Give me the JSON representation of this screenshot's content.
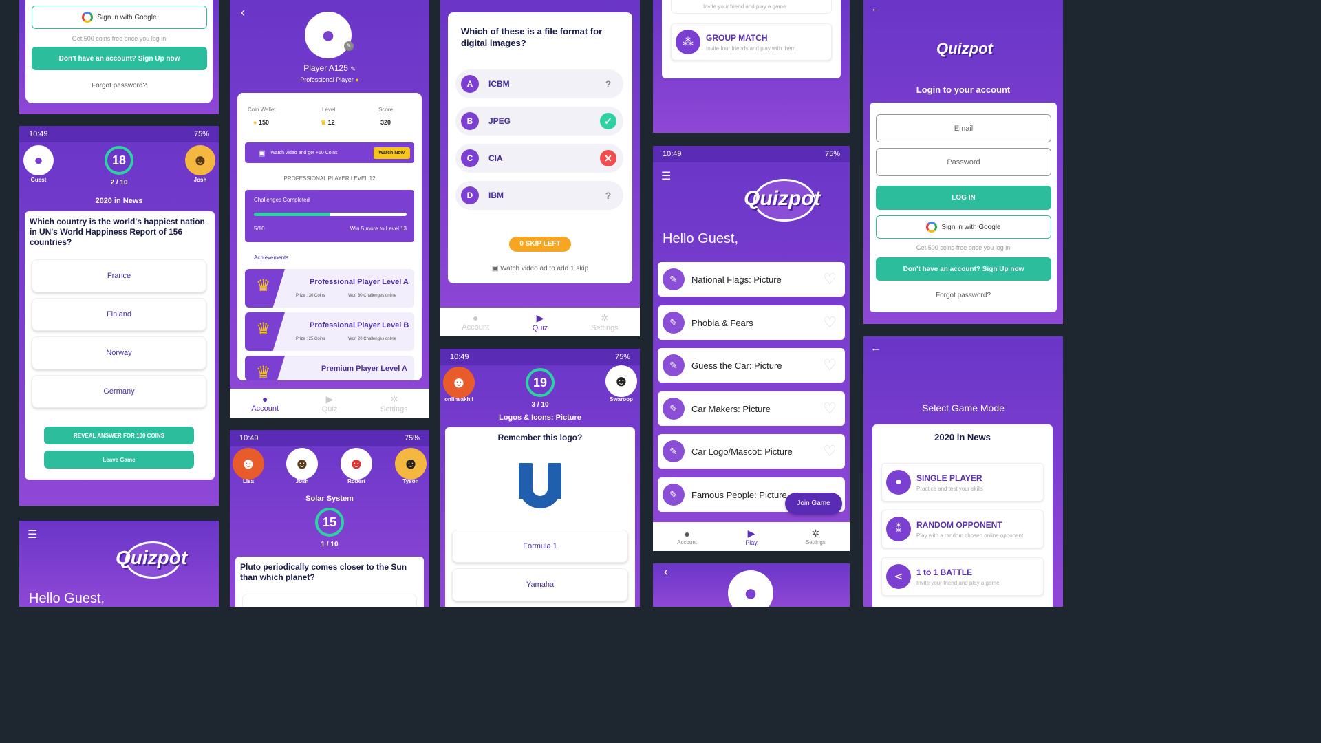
{
  "colors": {
    "purple": "#6a36c8",
    "teal": "#2bbd9c",
    "accent": "#2ed1a2",
    "orange": "#f6a623",
    "red": "#f04e4e",
    "yellow": "#f5c518"
  },
  "s1": {
    "google": "Sign in with Google",
    "coins_note": "Get 500 coins free once you log in",
    "signup": "Don't have an account? Sign Up now",
    "forgot": "Forgot password?"
  },
  "s2": {
    "time": "10:49",
    "battery": "75%",
    "p1": "Guest",
    "p2": "Josh",
    "timer": "18",
    "progress": "2 / 10",
    "topic": "2020 in News",
    "question": "Which country is the world's happiest nation in UN's World Happiness Report of 156 countries?",
    "answers": [
      "France",
      "Finland",
      "Norway",
      "Germany"
    ],
    "reveal": "REVEAL ANSWER FOR 100 COINS",
    "leave": "Leave Game"
  },
  "s3": {
    "greeting": "Hello Guest,",
    "logo": "Quizpot"
  },
  "s4": {
    "name": "Player A125",
    "subtitle": "Professional Player",
    "wallet_label": "Coin Wallet",
    "wallet": "150",
    "level_label": "Level",
    "level": "12",
    "score_label": "Score",
    "score": "320",
    "watch_text": "Watch video and get +10 Coins",
    "watch_btn": "Watch Now",
    "level_title": "PROFESSIONAL PLAYER LEVEL 12",
    "challenges": "Challenges Completed",
    "progress": "5/10",
    "progress_value": 0.5,
    "more": "Win 5 more to Level 13",
    "achievements": "Achievements",
    "ach": [
      {
        "name": "Professional Player Level A",
        "prize": "Prize : 30 Coins",
        "req": "Won 30 Challenges online"
      },
      {
        "name": "Professional Player Level B",
        "prize": "Prize : 25 Coins",
        "req": "Won 20 Challenges online"
      },
      {
        "name": "Premium Player Level A"
      }
    ],
    "tabs": [
      "Account",
      "Quiz",
      "Settings"
    ]
  },
  "s5": {
    "time": "10:49",
    "battery": "75%",
    "players": [
      "Lisa",
      "Josh",
      "Robert",
      "Tyson"
    ],
    "topic": "Solar System",
    "timer": "15",
    "progress": "1 / 10",
    "question": "Pluto periodically comes closer to the Sun than which planet?"
  },
  "s6": {
    "question": "Which of these is a file format for digital images?",
    "options": [
      {
        "letter": "A",
        "text": "ICBM",
        "mark": "?"
      },
      {
        "letter": "B",
        "text": "JPEG",
        "mark": "✓"
      },
      {
        "letter": "C",
        "text": "CIA",
        "mark": "✕"
      },
      {
        "letter": "D",
        "text": "IBM",
        "mark": "?"
      }
    ],
    "skip": "0 SKIP LEFT",
    "watch": "Watch video ad to add 1 skip",
    "tabs": [
      "Account",
      "Quiz",
      "Settings"
    ]
  },
  "s7": {
    "time": "10:49",
    "battery": "75%",
    "p1": "onlineakhil",
    "p2": "Swaroop",
    "timer": "19",
    "progress": "3 / 10",
    "topic": "Logos & Icons: Picture",
    "question": "Remember this logo?",
    "answers": [
      "Formula 1",
      "Yamaha"
    ]
  },
  "s8": {
    "top_text": "Invite your friend and play a game",
    "group": "GROUP MATCH",
    "group_sub": "Invite four friends and play with them"
  },
  "s9": {
    "time": "10:49",
    "battery": "75%",
    "logo": "Quizpot",
    "greeting": "Hello Guest,",
    "cats": [
      "National Flags: Picture",
      "Phobia & Fears",
      "Guess the Car: Picture",
      "Car Makers: Picture",
      "Car Logo/Mascot: Picture",
      "Famous People: Picture"
    ],
    "join": "Join Game",
    "tabs": [
      "Account",
      "Play",
      "Settings"
    ]
  },
  "s10": {
    "logo": "Quizpot",
    "title": "Login to your account",
    "email": "Email",
    "password": "Password",
    "login": "LOG IN",
    "google": "Sign in with Google",
    "coins_note": "Get 500 coins free once you log in",
    "signup": "Don't have an account? Sign Up now",
    "forgot": "Forgot password?"
  },
  "s11": {
    "title": "Select Game Mode",
    "topic": "2020 in News",
    "modes": [
      {
        "name": "SINGLE PLAYER",
        "sub": "Practice and test your skills"
      },
      {
        "name": "RANDOM OPPONENT",
        "sub": "Play with a random chosen online opponent"
      },
      {
        "name": "1 to 1 BATTLE",
        "sub": "Invite your friend and play a game"
      }
    ]
  }
}
